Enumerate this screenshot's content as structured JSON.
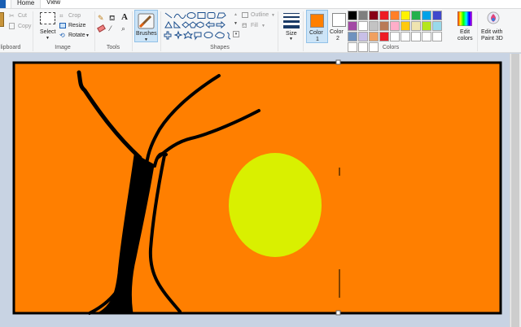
{
  "tabs": {
    "home": "Home",
    "view": "View"
  },
  "clipboard": {
    "cut": "Cut",
    "copy": "Copy",
    "group": "lipboard"
  },
  "image": {
    "select": "Select",
    "crop": "Crop",
    "resize": "Resize",
    "rotate": "Rotate",
    "group": "Image"
  },
  "tools": {
    "group": "Tools"
  },
  "brushes": {
    "label": "Brushes"
  },
  "shapes": {
    "outline": "Outline",
    "fill": "Fill",
    "group": "Shapes"
  },
  "size": {
    "label": "Size"
  },
  "colors": {
    "color1_label": "Color",
    "color1_num": "1",
    "color2_label": "Color",
    "color2_num": "2",
    "edit_colors_1": "Edit",
    "edit_colors_2": "colors",
    "edit_paint3d_1": "Edit with",
    "edit_paint3d_2": "Paint 3D",
    "group": "Colors",
    "color1_value": "#ff7f00",
    "color2_value": "#ffffff",
    "palette": [
      "#000000",
      "#7f7f7f",
      "#880015",
      "#ed1c24",
      "#ff7f27",
      "#fff200",
      "#22b14c",
      "#00a2e8",
      "#3f48cc",
      "#a349a4",
      "#ffffff",
      "#c3c3c3",
      "#b97a57",
      "#ffaec9",
      "#ffc90e",
      "#efe4b0",
      "#b5e61d",
      "#99d9ea",
      "#7092be",
      "#c8bfe7",
      "#f0a060",
      "#ed1c24",
      "#ffffff",
      "#ffffff",
      "#ffffff",
      "#ffffff",
      "#ffffff",
      "#ffffff",
      "#ffffff",
      "#ffffff"
    ]
  },
  "drawing": {
    "background": "#ff7f00",
    "sun_color": "#d9f000",
    "tree_color": "#000000"
  }
}
